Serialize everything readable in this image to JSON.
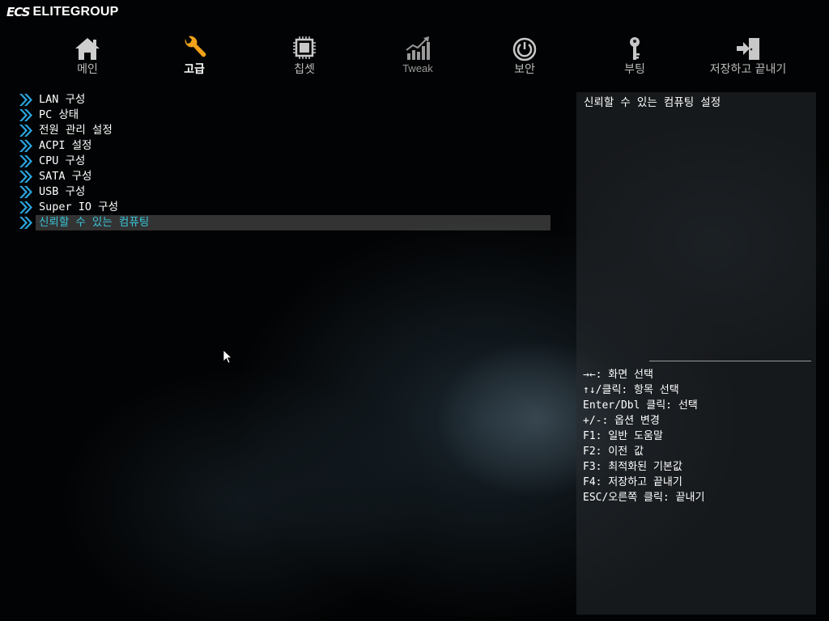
{
  "brand": {
    "mark": "ECS",
    "name": "ELITEGROUP"
  },
  "nav": [
    {
      "label": "메인",
      "icon": "home-icon",
      "state": "normal"
    },
    {
      "label": "고급",
      "icon": "wrench-icon",
      "state": "active"
    },
    {
      "label": "칩셋",
      "icon": "chip-icon",
      "state": "normal"
    },
    {
      "label": "Tweak",
      "icon": "chart-icon",
      "state": "dim"
    },
    {
      "label": "보안",
      "icon": "power-icon",
      "state": "normal"
    },
    {
      "label": "부팅",
      "icon": "key-icon",
      "state": "normal"
    },
    {
      "label": "저장하고 끝내기",
      "icon": "exit-icon",
      "state": "normal"
    }
  ],
  "menu": [
    "LAN 구성",
    "PC 상태",
    "전원 관리 설정",
    "ACPI 설정",
    "CPU 구성",
    "SATA 구성",
    "USB 구성",
    "Super IO 구성",
    "신뢰할 수 있는 컴퓨팅"
  ],
  "selected_index": 8,
  "help": {
    "title": "신뢰할 수 있는 컴퓨팅 설정",
    "keys": [
      "→←: 화면 선택",
      "↑↓/클릭: 항목 선택",
      "Enter/Dbl 클릭: 선택",
      "+/-: 옵션 변경",
      "F1: 일반 도움말",
      "F2: 이전 값",
      "F3: 최적화된 기본값",
      "F4: 저장하고 끝내기",
      "ESC/오른쪽 클릭: 끝내기"
    ]
  },
  "colors": {
    "selected_text": "#39c6d8",
    "arrow": "#2aa6e0",
    "active_icon": "#f2a21a"
  }
}
